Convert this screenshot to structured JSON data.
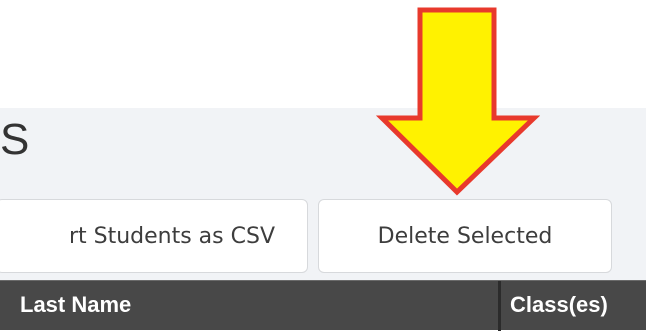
{
  "page": {
    "title_fragment": "S"
  },
  "toolbar": {
    "export_label": "rt Students as CSV",
    "delete_label": "Delete Selected"
  },
  "table": {
    "columns": [
      "Last Name",
      "Class(es)"
    ]
  },
  "annotation": {
    "arrow_icon": "down-arrow-icon",
    "arrow_fill": "#fff200",
    "arrow_stroke": "#e8392c"
  },
  "colors": {
    "panel_bg": "#f1f3f6",
    "table_header_bg": "#484848"
  }
}
